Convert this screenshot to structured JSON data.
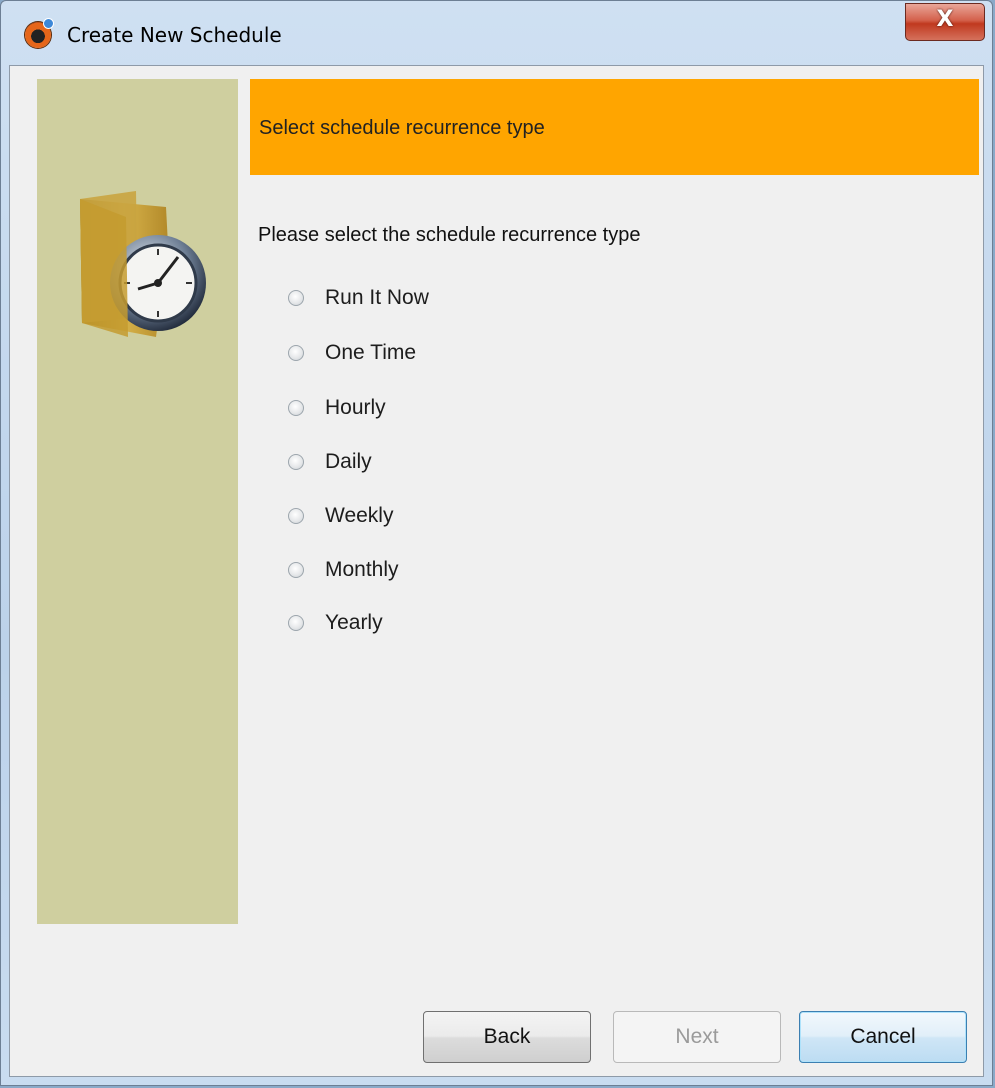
{
  "window": {
    "title": "Create New Schedule",
    "close_label": "X"
  },
  "header": {
    "title": "Select schedule recurrence type",
    "color": "#ffa500"
  },
  "side_panel": {
    "color": "#cfcf9f",
    "icon": "clock-folder-icon"
  },
  "prompt": "Please select the schedule recurrence type",
  "options": [
    {
      "label": "Run It Now",
      "selected": false
    },
    {
      "label": "One Time",
      "selected": false
    },
    {
      "label": "Hourly",
      "selected": false
    },
    {
      "label": "Daily",
      "selected": false
    },
    {
      "label": "Weekly",
      "selected": false
    },
    {
      "label": "Monthly",
      "selected": false
    },
    {
      "label": "Yearly",
      "selected": false
    }
  ],
  "buttons": {
    "back": "Back",
    "next": "Next",
    "cancel": "Cancel",
    "next_enabled": false
  }
}
